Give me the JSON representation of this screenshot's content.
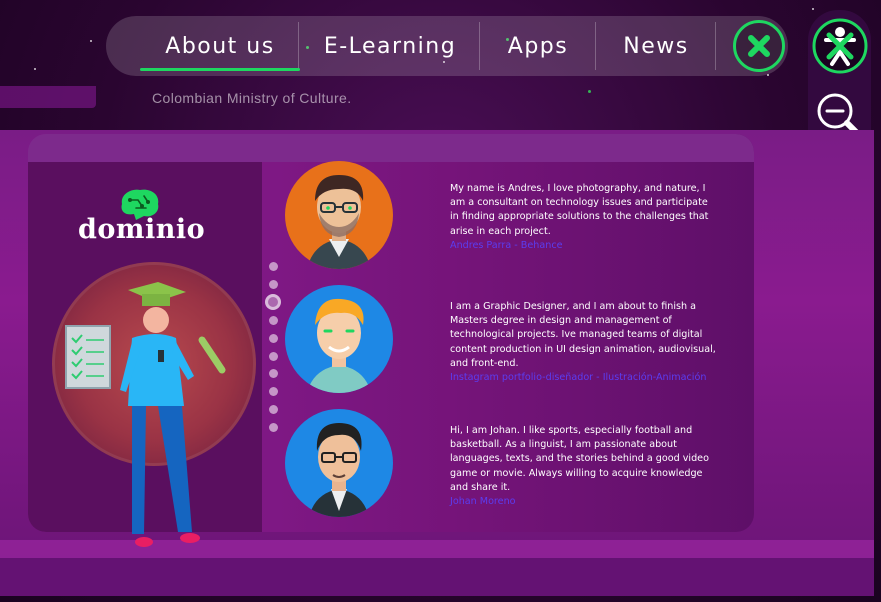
{
  "nav": {
    "items": [
      {
        "label": "About us",
        "active": true
      },
      {
        "label": "E-Learning",
        "active": false
      },
      {
        "label": "Apps",
        "active": false
      },
      {
        "label": "News",
        "active": false
      }
    ],
    "close_icon": "close-icon"
  },
  "tools": [
    {
      "icon": "accessibility-close-icon"
    },
    {
      "icon": "zoom-out-icon"
    },
    {
      "icon": "zoom-in-icon"
    },
    {
      "icon": "contrast-icon"
    },
    {
      "icon": "refresh-icon"
    }
  ],
  "subtitle": "Colombian Ministry of Culture.",
  "brand": {
    "name": "dominio",
    "accent": "#1ed760"
  },
  "team": [
    {
      "bio": "My name is Andres, I love photography, and nature, I am a consultant on technology issues and participate in finding appropriate solutions to the challenges that arise in each project.",
      "link": "Andres Parra - Behance"
    },
    {
      "bio": "I am a Graphic Designer, and I am about to finish a Masters degree in design and management of technological projects. Ive managed teams of digital content production in UI design animation, audiovisual, and front-end.",
      "link": "Instagram portfolio-diseñador - Ilustración-Animación"
    },
    {
      "bio": "Hi, I am Johan. I like sports, especially football and basketball. As a linguist, I am passionate about languages, texts, and the stories behind a good video game or movie. Always willing to acquire knowledge and share it.",
      "link": "Johan Moreno"
    }
  ],
  "pager": {
    "total": 10,
    "active_index": 2
  },
  "colors": {
    "background": "#2a0530",
    "band": "#7a1c86",
    "accent": "#1ed760",
    "link": "#5b3df0"
  }
}
